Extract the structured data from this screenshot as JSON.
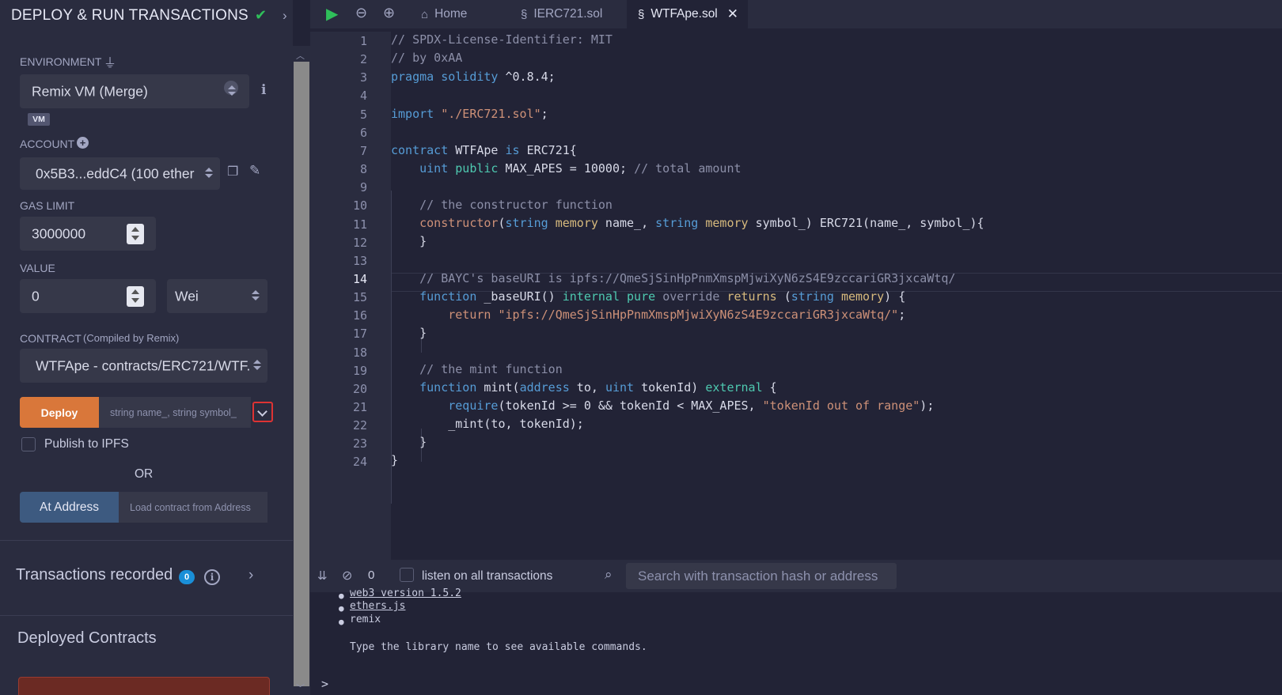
{
  "left_panel": {
    "title": "DEPLOY & RUN TRANSACTIONS",
    "environment_label": "ENVIRONMENT",
    "environment_value": "Remix VM (Merge)",
    "vm_badge": "VM",
    "account_label": "ACCOUNT",
    "account_value": "0x5B3...eddC4 (100 ether",
    "gas_limit_label": "GAS LIMIT",
    "gas_limit_value": "3000000",
    "value_label": "VALUE",
    "value_amount": "0",
    "value_unit": "Wei",
    "contract_label": "CONTRACT",
    "contract_compiled_by": "(Compiled by Remix)",
    "contract_value": "WTFApe - contracts/ERC721/WTF.",
    "deploy_label": "Deploy",
    "deploy_args_placeholder": "string name_, string symbol_",
    "publish_ipfs_label": "Publish to IPFS",
    "or_label": "OR",
    "at_address_label": "At Address",
    "load_contract_placeholder": "Load contract from Address",
    "transactions_recorded_label": "Transactions recorded",
    "transactions_recorded_count": "0",
    "deployed_contracts_label": "Deployed Contracts"
  },
  "tabs": [
    {
      "label": "Home",
      "icon": "home-icon"
    },
    {
      "label": "IERC721.sol",
      "icon": "solidity-icon"
    },
    {
      "label": "WTFApe.sol",
      "icon": "solidity-icon",
      "active": true
    }
  ],
  "editor": {
    "current_line": 14,
    "line_numbers": [
      "1",
      "2",
      "3",
      "4",
      "5",
      "6",
      "7",
      "8",
      "9",
      "10",
      "11",
      "12",
      "13",
      "14",
      "15",
      "16",
      "17",
      "18",
      "19",
      "20",
      "21",
      "22",
      "23",
      "24"
    ]
  },
  "terminal": {
    "count": "0",
    "listen_label": "listen on all transactions",
    "search_placeholder": "Search with transaction hash or address",
    "lines": [
      "web3 version 1.5.2",
      "ethers.js",
      "remix",
      "Type the library name to see available commands."
    ],
    "prompt": ">"
  },
  "colors": {
    "accent_deploy": "#d9773a",
    "at_address": "#3d5a80",
    "badge": "#1a8fd8",
    "success": "#2fbf5a"
  }
}
